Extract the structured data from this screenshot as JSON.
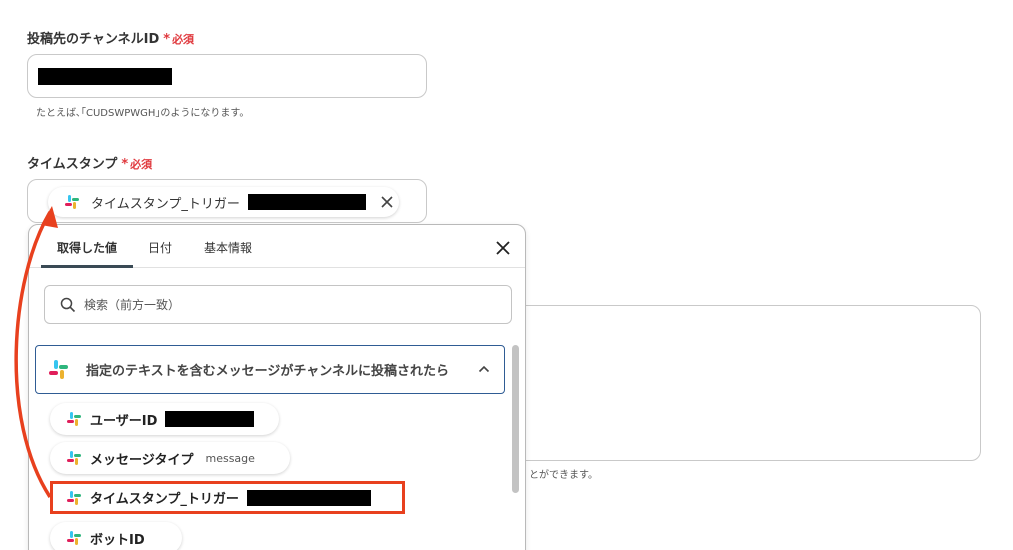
{
  "channel_field": {
    "label": "投稿先のチャンネルID",
    "required_label": "必須",
    "hint": "たとえば､｢CUDSWPWGH｣のようになります。"
  },
  "timestamp_field": {
    "label": "タイムスタンプ",
    "required_label": "必須",
    "chip_label": "タイムスタンプ_トリガー"
  },
  "background_hint_tail": "とができます。",
  "panel": {
    "tabs": [
      {
        "label": "取得した値"
      },
      {
        "label": "日付"
      },
      {
        "label": "基本情報"
      }
    ],
    "search_placeholder": "検索（前方一致）",
    "group_label": "指定のテキストを含むメッセージがチャンネルに投稿されたら",
    "items": [
      {
        "label": "ユーザーID",
        "extra": ""
      },
      {
        "label": "メッセージタイプ",
        "extra": "message"
      },
      {
        "label": "タイムスタンプ_トリガー",
        "extra": ""
      },
      {
        "label": "ボットID",
        "extra": ""
      }
    ]
  },
  "colors": {
    "required": "#e0393e",
    "annotation": "#e8401e",
    "group_border": "#2f5c94",
    "slack_blue": "#36c5f0",
    "slack_green": "#2eb67d",
    "slack_yellow": "#ecb22e",
    "slack_red": "#e01e5a"
  },
  "icons": {
    "app_icon": "slack-logo-icon",
    "remove": "close-icon",
    "close_panel": "close-icon",
    "search": "search-icon",
    "collapse": "chevron-up-icon"
  }
}
